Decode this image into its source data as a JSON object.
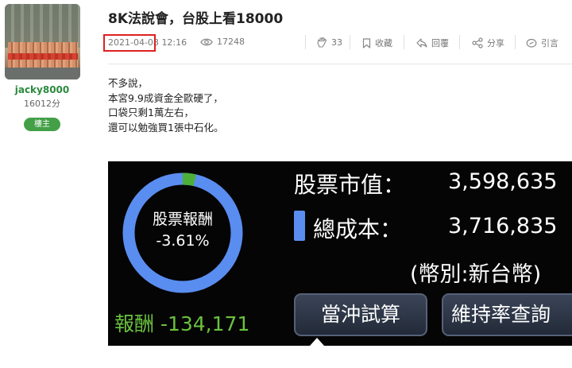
{
  "author": {
    "username": "jacky8000",
    "points": "16012分",
    "badge": "樓主"
  },
  "post": {
    "title": "8K法說會，台股上看18000",
    "date": "2021-04-08",
    "time": "12:16",
    "views": "17248",
    "likes": "33",
    "actions": {
      "favorite": "收藏",
      "reply": "回覆",
      "share": "分享",
      "quote": "引言"
    },
    "lines": [
      "不多說，",
      "本宮9.9成資金全歐硬了，",
      "口袋只剩1萬左右，",
      "還可以勉強買1張中石化。"
    ]
  },
  "screenshot": {
    "ring_label": "股票報酬",
    "return_pct": "-3.61%",
    "return_fraction": -0.0361,
    "return_label": "報酬 -134,171",
    "market_value_label": "股票市值：",
    "market_value": "3,598,635",
    "cost_label": "總成本：",
    "cost": "3,716,835",
    "currency": "(幣別:新台幣)",
    "btn_day_trade": "當沖試算",
    "btn_maintenance": "維持率查詢",
    "colors": {
      "ring_blue": "#5a8df0",
      "ring_green": "#4caf3a",
      "return_green": "#6ac23d"
    }
  },
  "icons": {
    "views": "eye-icon",
    "likes": "clap-icon",
    "favorite": "bookmark-icon",
    "reply": "reply-arrow-icon",
    "share": "share-icon",
    "quote": "quote-icon"
  }
}
